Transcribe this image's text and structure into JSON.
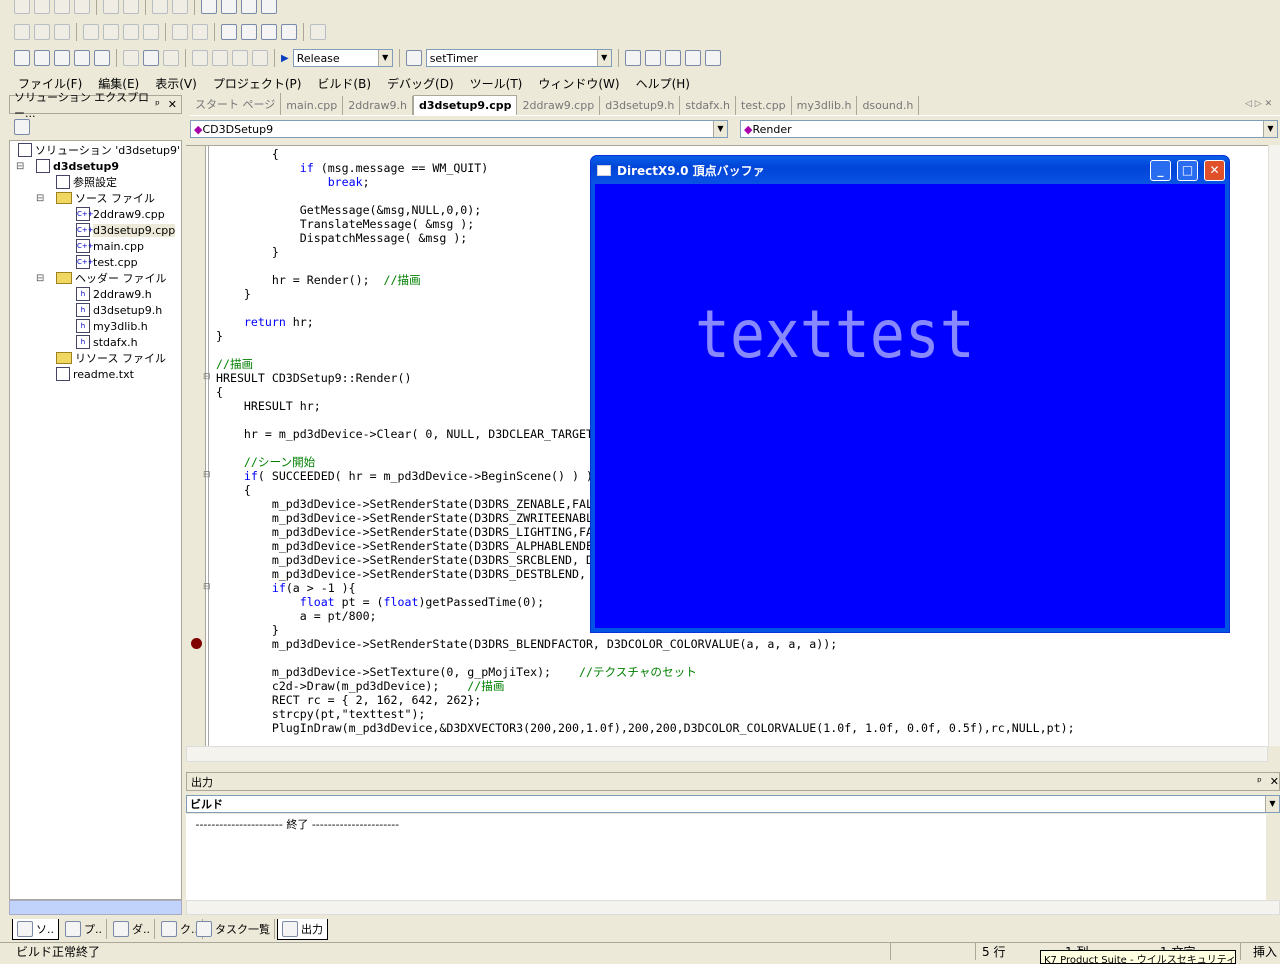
{
  "toolbar": {
    "config_value": "Release",
    "target_value": "setTimer"
  },
  "menu": [
    "ファイル(F)",
    "編集(E)",
    "表示(V)",
    "プロジェクト(P)",
    "ビルド(B)",
    "デバッグ(D)",
    "ツール(T)",
    "ウィンドウ(W)",
    "ヘルプ(H)"
  ],
  "solution_explorer": {
    "title": "ソリューション エクスプロー...",
    "pin": "ᵖ",
    "close": "✕",
    "items": [
      {
        "label": "ソリューション 'd3dsetup9' (1 プ",
        "type": "solution",
        "level": 0
      },
      {
        "label": "d3dsetup9",
        "type": "project",
        "level": 0,
        "bold": true
      },
      {
        "label": "参照設定",
        "type": "ref",
        "level": 1
      },
      {
        "label": "ソース ファイル",
        "type": "folder",
        "level": 1
      },
      {
        "label": "2ddraw9.cpp",
        "type": "cpp",
        "level": 2
      },
      {
        "label": "d3dsetup9.cpp",
        "type": "cpp",
        "level": 2,
        "selected": true
      },
      {
        "label": "main.cpp",
        "type": "cpp",
        "level": 2
      },
      {
        "label": "test.cpp",
        "type": "cpp",
        "level": 2
      },
      {
        "label": "ヘッダー ファイル",
        "type": "folder",
        "level": 1
      },
      {
        "label": "2ddraw9.h",
        "type": "h",
        "level": 2
      },
      {
        "label": "d3dsetup9.h",
        "type": "h",
        "level": 2
      },
      {
        "label": "my3dlib.h",
        "type": "h",
        "level": 2
      },
      {
        "label": "stdafx.h",
        "type": "h",
        "level": 2
      },
      {
        "label": "リソース ファイル",
        "type": "folder",
        "level": 1
      },
      {
        "label": "readme.txt",
        "type": "txt",
        "level": 1
      }
    ],
    "bottom_tabs": [
      "ソ..",
      "プ..",
      "ダ..",
      "ク.."
    ]
  },
  "editor": {
    "tabs": [
      "スタート ページ",
      "main.cpp",
      "2ddraw9.h",
      "d3dsetup9.cpp",
      "2ddraw9.cpp",
      "d3dsetup9.h",
      "stdafx.h",
      "test.cpp",
      "my3dlib.h",
      "dsound.h"
    ],
    "active_tab": "d3dsetup9.cpp",
    "class_combo": "CD3DSetup9",
    "member_combo": "Render",
    "breakpoint_line": 35,
    "lines": [
      "        {",
      "            if (msg.message == WM_QUIT)",
      "                break;",
      "",
      "            GetMessage(&msg,NULL,0,0);",
      "            TranslateMessage( &msg );",
      "            DispatchMessage( &msg );",
      "        }",
      "",
      "        hr = Render();  //描画",
      "    }",
      "",
      "    return hr;",
      "}",
      "",
      "//描画",
      "HRESULT CD3DSetup9::Render()",
      "{",
      "    HRESULT hr;",
      "",
      "    hr = m_pd3dDevice->Clear( 0, NULL, D3DCLEAR_TARGET",
      "",
      "    //シーン開始",
      "    if( SUCCEEDED( hr = m_pd3dDevice->BeginScene() ) )",
      "    {",
      "        m_pd3dDevice->SetRenderState(D3DRS_ZENABLE,FAL",
      "        m_pd3dDevice->SetRenderState(D3DRS_ZWRITEENABL",
      "        m_pd3dDevice->SetRenderState(D3DRS_LIGHTING,FA",
      "        m_pd3dDevice->SetRenderState(D3DRS_ALPHABLENDE",
      "        m_pd3dDevice->SetRenderState(D3DRS_SRCBLEND, D",
      "        m_pd3dDevice->SetRenderState(D3DRS_DESTBLEND, ",
      "        if(a > -1 ){",
      "            float pt = (float)getPassedTime(0);",
      "            a = pt/800;",
      "        }",
      "        m_pd3dDevice->SetRenderState(D3DRS_BLENDFACTOR, D3DCOLOR_COLORVALUE(a, a, a, a));",
      "",
      "        m_pd3dDevice->SetTexture(0, g_pMojiTex);    //テクスチャのセット",
      "        c2d->Draw(m_pd3dDevice);    //描画",
      "        RECT rc = { 2, 162, 642, 262};",
      "        strcpy(pt,\"texttest\");",
      "        PlugInDraw(m_pd3dDevice,&D3DXVECTOR3(200,200,1.0f),200,200,D3DCOLOR_COLORVALUE(1.0f, 1.0f, 0.0f, 0.5f),rc,NULL,pt);"
    ]
  },
  "dx_window": {
    "title": "DirectX9.0  頂点バッファ",
    "text": "texttest",
    "client_color": "#0000ff",
    "text_color": "#8888ff"
  },
  "output": {
    "title": "出力",
    "combo": "ビルド",
    "text": " ---------------------- 終了 ----------------------",
    "bottom_tabs": [
      "タスク一覧",
      "出力"
    ]
  },
  "status": {
    "message": "ビルド正常終了",
    "line": "5 行",
    "col": "1 列",
    "char": "1 文字",
    "mode": "挿入",
    "tooltip": "K7 Product Suite - ウイルスセキュリティ"
  }
}
